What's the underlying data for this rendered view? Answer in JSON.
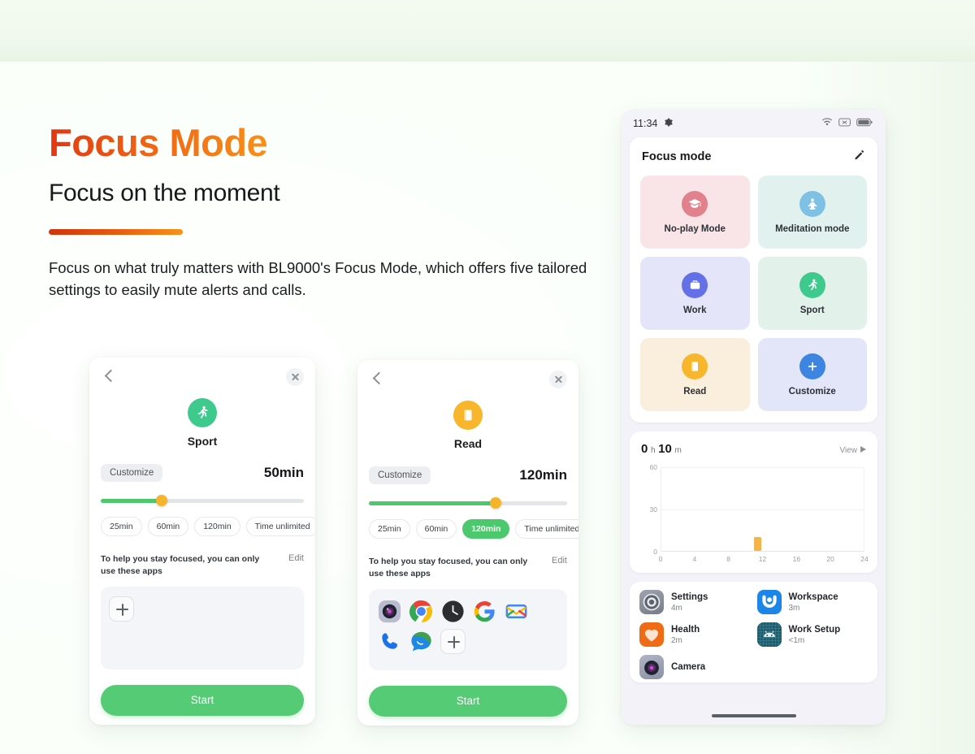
{
  "hero": {
    "headline": "Focus Mode",
    "subhead": "Focus on the moment",
    "body": "Focus on what truly matters with BL9000's Focus Mode, which offers five tailored settings to easily mute alerts and calls.",
    "accent_start": "#e23712",
    "accent_end": "#f89018"
  },
  "phone_sport": {
    "back_label": "Back",
    "close_label": "Close",
    "mode_name": "Sport",
    "mode_icon": "running-icon",
    "mode_icon_color": "#3ec98d",
    "customize_label": "Customize",
    "duration_value": "50min",
    "slider_percent": 30,
    "presets": [
      {
        "label": "25min",
        "selected": false
      },
      {
        "label": "60min",
        "selected": false
      },
      {
        "label": "120min",
        "selected": false
      },
      {
        "label": "Time unlimited",
        "selected": false
      }
    ],
    "apps_hint": "To help you stay focused, you can only use these apps",
    "edit_label": "Edit",
    "apps": [],
    "add_app_label": "Add app",
    "start_label": "Start"
  },
  "phone_read": {
    "back_label": "Back",
    "close_label": "Close",
    "mode_name": "Read",
    "mode_icon": "book-icon",
    "mode_icon_color": "#f8b62c",
    "customize_label": "Customize",
    "duration_value": "120min",
    "slider_percent": 64,
    "presets": [
      {
        "label": "25min",
        "selected": false
      },
      {
        "label": "60min",
        "selected": false
      },
      {
        "label": "120min",
        "selected": true
      },
      {
        "label": "Time unlimited",
        "selected": false
      }
    ],
    "apps_hint": "To help you stay focused, you can only use these apps",
    "edit_label": "Edit",
    "apps": [
      "camera-icon",
      "chrome-icon",
      "clock-icon",
      "google-icon",
      "gmail-icon",
      "phone-icon",
      "messages-icon"
    ],
    "add_app_label": "Add app",
    "start_label": "Start"
  },
  "phone_home": {
    "status": {
      "time": "11:34",
      "settings_icon": "gear-icon",
      "right_icons": [
        "wifi-icon",
        "no-sim-icon",
        "battery-icon"
      ]
    },
    "card_title": "Focus mode",
    "edit_icon": "pencil-icon",
    "modes": [
      {
        "label": "No-play Mode",
        "icon": "graduation-cap-icon",
        "tile_bg": "#f9e4e8",
        "icon_bg": "#e2818b"
      },
      {
        "label": "Meditation mode",
        "icon": "meditation-icon",
        "tile_bg": "#e1f2ee",
        "icon_bg": "#7fc1e5"
      },
      {
        "label": "Work",
        "icon": "briefcase-icon",
        "tile_bg": "#e4e5f9",
        "icon_bg": "#6370e8"
      },
      {
        "label": "Sport",
        "icon": "running-icon",
        "tile_bg": "#e3f1eb",
        "icon_bg": "#3ec98d"
      },
      {
        "label": "Read",
        "icon": "book-icon",
        "tile_bg": "#faeedc",
        "icon_bg": "#f8b62c"
      },
      {
        "label": "Customize",
        "icon": "plus-icon",
        "tile_bg": "#e3e5f9",
        "icon_bg": "#3d85e0"
      }
    ],
    "usage": {
      "total_hours": "0",
      "hours_unit": "h",
      "total_minutes": "10",
      "minutes_unit": "m",
      "view_label": "View",
      "apps": [
        {
          "name": "Settings",
          "time": "4m",
          "icon": "settings-gear-icon",
          "bg": "#8e939c"
        },
        {
          "name": "Workspace",
          "time": "3m",
          "icon": "workspace-icon",
          "bg": "#1b86e8"
        },
        {
          "name": "Health",
          "time": "2m",
          "icon": "health-heart-icon",
          "bg": "#ef6b16"
        },
        {
          "name": "Work Setup",
          "time": "<1m",
          "icon": "android-robot-icon",
          "bg": "#1c5b6b"
        },
        {
          "name": "Camera",
          "time": "",
          "icon": "camera-icon",
          "bg": "#9ba0b5"
        }
      ]
    }
  },
  "chart_data": {
    "type": "bar",
    "title": "0 h 10 m",
    "xlabel": "",
    "ylabel": "",
    "x": [
      0,
      4,
      8,
      12,
      16,
      20,
      24
    ],
    "xtick_labels": [
      "0",
      "4",
      "8",
      "12",
      "16",
      "20",
      "24"
    ],
    "ytick_labels": [
      "0",
      "30",
      "60"
    ],
    "xlim": [
      0,
      24
    ],
    "ylim": [
      0,
      60
    ],
    "grid": true,
    "legend": "none",
    "bars": [
      {
        "x": 11,
        "value": 10,
        "color": "#f3b54b"
      }
    ],
    "note": "Single bar at hour 11 with value ~10 minutes; y axis in minutes 0-60"
  }
}
